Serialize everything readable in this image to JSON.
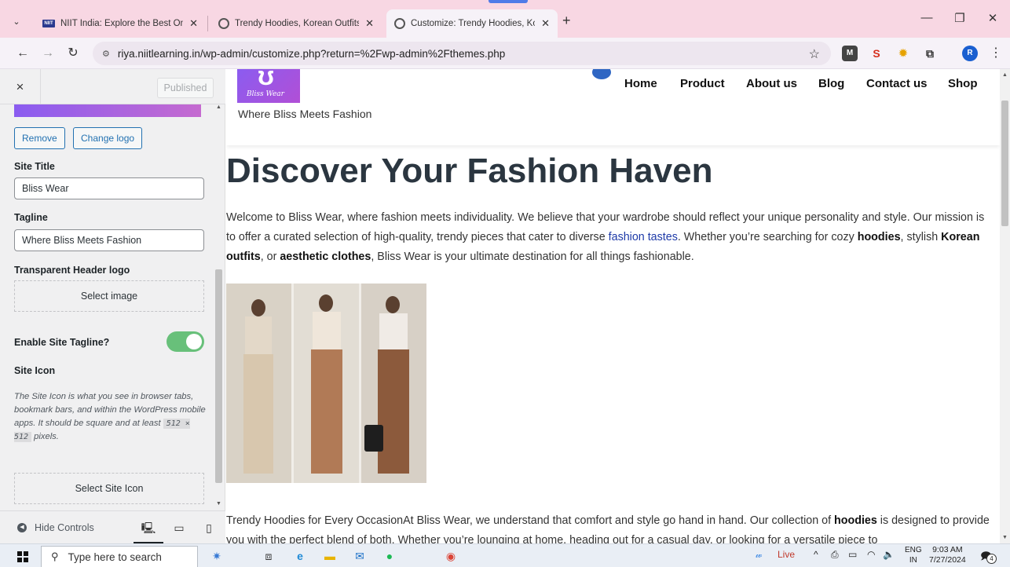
{
  "browser": {
    "tabs": [
      {
        "title": "NIIT India: Explore the Best Onli",
        "favicon": "niit-logo-icon",
        "favicon_text": "NIIT"
      },
      {
        "title": "Trendy Hoodies, Korean Outfits",
        "favicon": "globe-icon"
      },
      {
        "title": "Customize: Trendy Hoodies, Kor",
        "favicon": "globe-icon",
        "active": true
      }
    ],
    "new_tab_label": "+",
    "url": "riya.niitlearning.in/wp-admin/customize.php?return=%2Fwp-admin%2Fthemes.php",
    "profile_initial": "R",
    "colors": {
      "tab_strip": "#f8d7e3",
      "toolbar": "#f6f2f8",
      "profile": "#1a5fd0"
    }
  },
  "customizer": {
    "close_label": "×",
    "published_label": "Published",
    "remove_label": "Remove",
    "change_logo_label": "Change logo",
    "site_title_label": "Site Title",
    "site_title_value": "Bliss Wear",
    "tagline_label": "Tagline",
    "tagline_value": "Where Bliss Meets Fashion",
    "transparent_logo_label": "Transparent Header logo",
    "select_image_label": "Select image",
    "enable_tagline_label": "Enable Site Tagline?",
    "enable_tagline_on": true,
    "site_icon_label": "Site Icon",
    "site_icon_desc": "The Site Icon is what you see in browser tabs, bookmark bars, and within the WordPress mobile apps. It should be square and at least",
    "site_icon_size": "512 × 512",
    "site_icon_desc_end": "pixels.",
    "select_site_icon_label": "Select Site Icon",
    "hide_controls_label": "Hide Controls",
    "colors": {
      "accent": "#2271b1",
      "toggle_on": "#68c07a"
    }
  },
  "site": {
    "logo_script": "Bliss Wear",
    "tagline": "Where Bliss Meets Fashion",
    "nav": [
      "Home",
      "Product",
      "About us",
      "Blog",
      "Contact us",
      "Shop"
    ],
    "hero_title": "Discover Your Fashion Haven",
    "intro": {
      "part1": "Welcome to Bliss Wear, where fashion meets individuality. We believe that your wardrobe should reflect your unique personality and style. Our mission is to offer a curated selection of high-quality, trendy pieces that cater to diverse ",
      "link": "fashion tastes",
      "part2": ". Whether you’re searching for cozy ",
      "b1": "hoodies",
      "part3": ", stylish ",
      "b2": "Korean outfits",
      "part4": ", or ",
      "b3": "aesthetic clothes",
      "part5": ", Bliss Wear is your ultimate destination for all things fashionable."
    },
    "section2": {
      "part1": "Trendy Hoodies for Every OccasionAt Bliss Wear, we understand that comfort and style go hand in hand. Our collection of ",
      "b1": "hoodies",
      "part2": " is designed to provide you with the perfect blend of both. Whether you’re lounging at home, heading out for a casual day, or looking for a versatile piece to"
    },
    "colors": {
      "logo_gradient_start": "#8b5cf0",
      "logo_gradient_end": "#b14fd6",
      "title": "#2b3640",
      "link": "#1e3aa8"
    }
  },
  "taskbar": {
    "search_placeholder": "Type here to search",
    "live_label": "Live",
    "lang_top": "ENG",
    "lang_bottom": "IN",
    "time": "9:03 AM",
    "date": "7/27/2024",
    "notification_count": "4"
  }
}
